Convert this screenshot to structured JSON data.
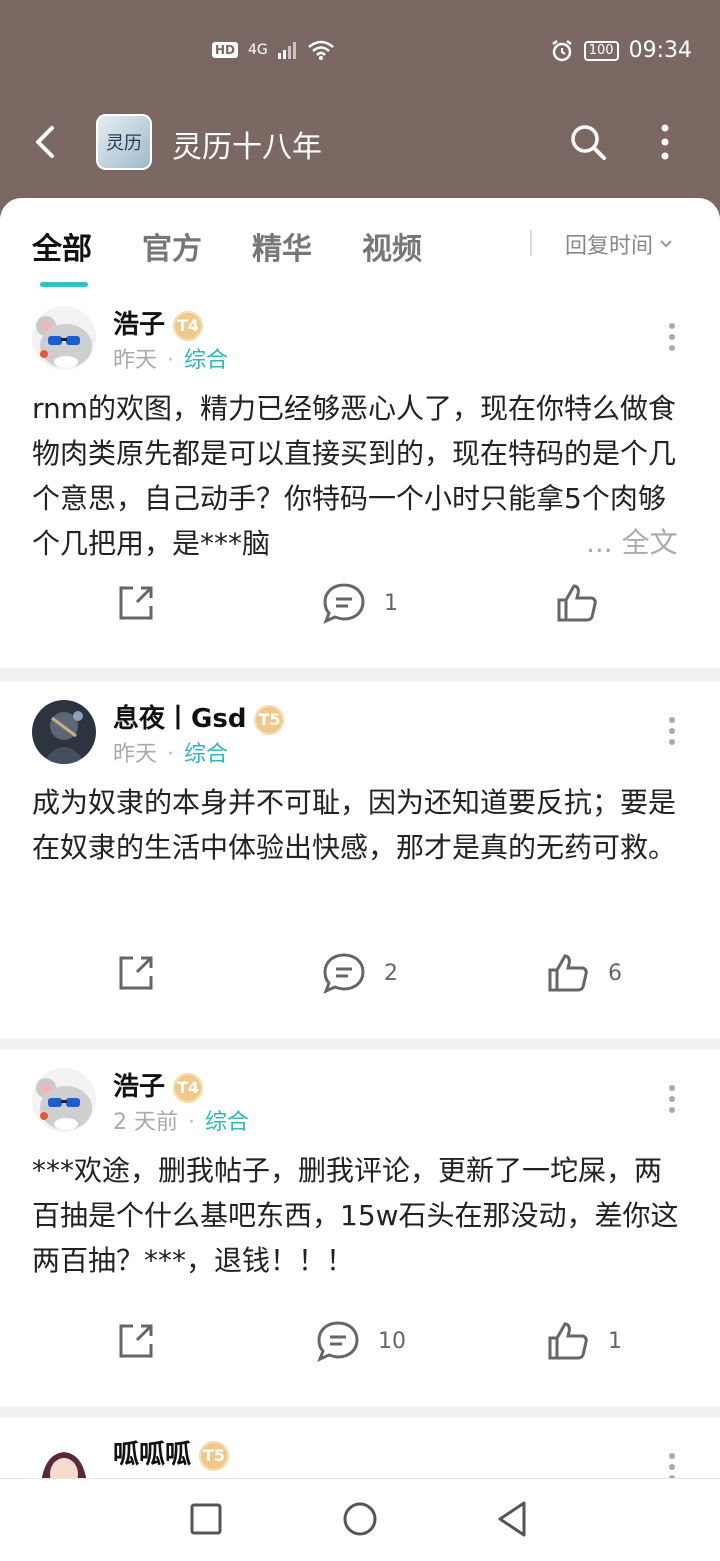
{
  "status_bar": {
    "network_hd": "HD",
    "network_gen": "4G",
    "battery": "100",
    "time": "09:34"
  },
  "app_bar": {
    "title": "灵历十八年",
    "logo_text": "灵历"
  },
  "tabs": [
    {
      "label": "全部",
      "active": true
    },
    {
      "label": "官方",
      "active": false
    },
    {
      "label": "精华",
      "active": false
    },
    {
      "label": "视频",
      "active": false
    }
  ],
  "sort": {
    "label": "回复时间"
  },
  "posts": [
    {
      "username": "浩子",
      "badge": "T4",
      "time": "昨天",
      "category": "综合",
      "content": "rnm的欢图，精力已经够恶心人了，现在你特么做食物肉类原先都是可以直接买到的，现在特码的是个几个意思，自己动手？你特码一个小时只能拿5个肉够个几把用，是***脑",
      "ellipsis": "...",
      "full_text": "全文",
      "comments": "1",
      "likes": ""
    },
    {
      "username": "息夜丨Gsd",
      "badge": "T5",
      "time": "昨天",
      "category": "综合",
      "content": "成为奴隶的本身并不可耻，因为还知道要反抗；要是在奴隶的生活中体验出快感，那才是真的无药可救。",
      "comments": "2",
      "likes": "6"
    },
    {
      "username": "浩子",
      "badge": "T4",
      "time": "2 天前",
      "category": "综合",
      "content": "***欢途，删我帖子，删我评论，更新了一坨屎，两百抽是个什么基吧东西，15w石头在那没动，差你这两百抽？***，退钱！！！",
      "comments": "10",
      "likes": "1"
    },
    {
      "username": "呱呱呱",
      "badge": "T5"
    }
  ],
  "colors": {
    "accent": "#2fc2c6",
    "header_bg": "#7b6862"
  }
}
